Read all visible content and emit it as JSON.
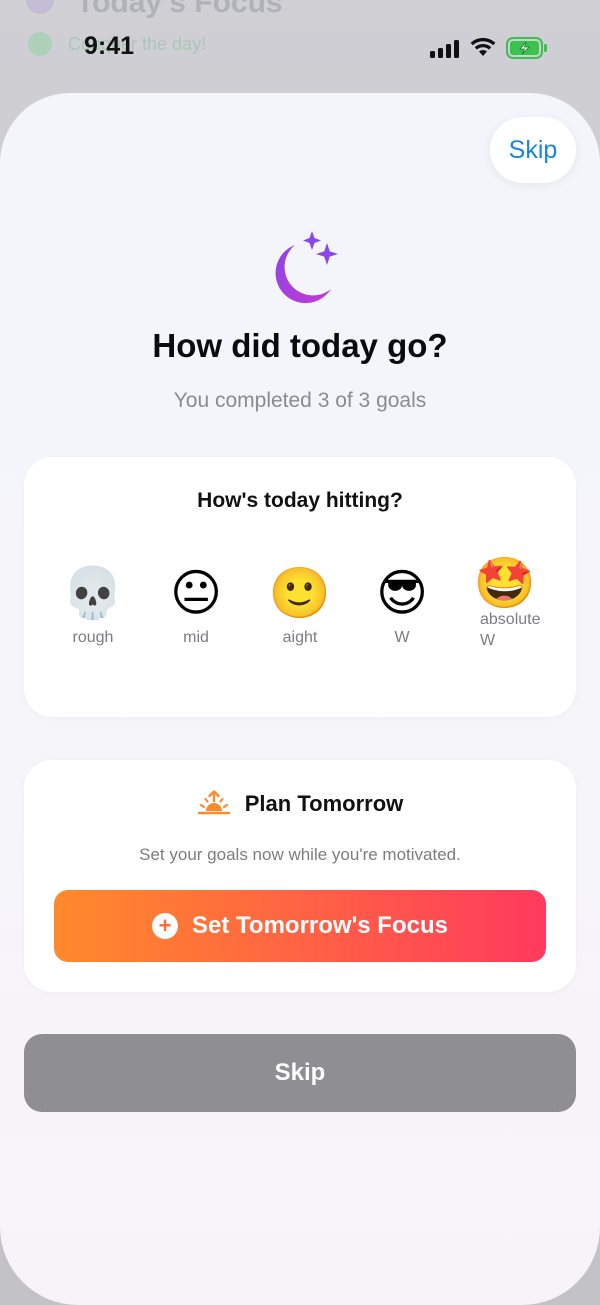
{
  "background": {
    "title": "Today's Focus",
    "item": "Conquer the day!"
  },
  "status": {
    "time": "9:41"
  },
  "header": {
    "skip_label": "Skip"
  },
  "hero": {
    "icon": "moon-stars-icon",
    "title": "How did today go?",
    "subtitle": "You completed 3 of 3 goals"
  },
  "mood": {
    "title": "How's today hitting?",
    "options": [
      {
        "emoji": "💀",
        "label": "rough"
      },
      {
        "emoji": "😐",
        "label": "mid"
      },
      {
        "emoji": "🙂",
        "label": "aight"
      },
      {
        "emoji": "😎",
        "label": "W"
      },
      {
        "emoji": "🤩",
        "label": "absolute W"
      }
    ]
  },
  "plan": {
    "icon": "sunrise-icon",
    "title": "Plan Tomorrow",
    "subtitle": "Set your goals now while you're motivated.",
    "button_label": "Set Tomorrow's Focus"
  },
  "footer": {
    "skip_label": "Skip"
  },
  "colors": {
    "accent_blue": "#1a86d8",
    "cta_start": "#ff8a2b",
    "cta_end": "#ff3a5e",
    "moon": "#a64ddb",
    "skip_gray": "#8e8e93"
  }
}
